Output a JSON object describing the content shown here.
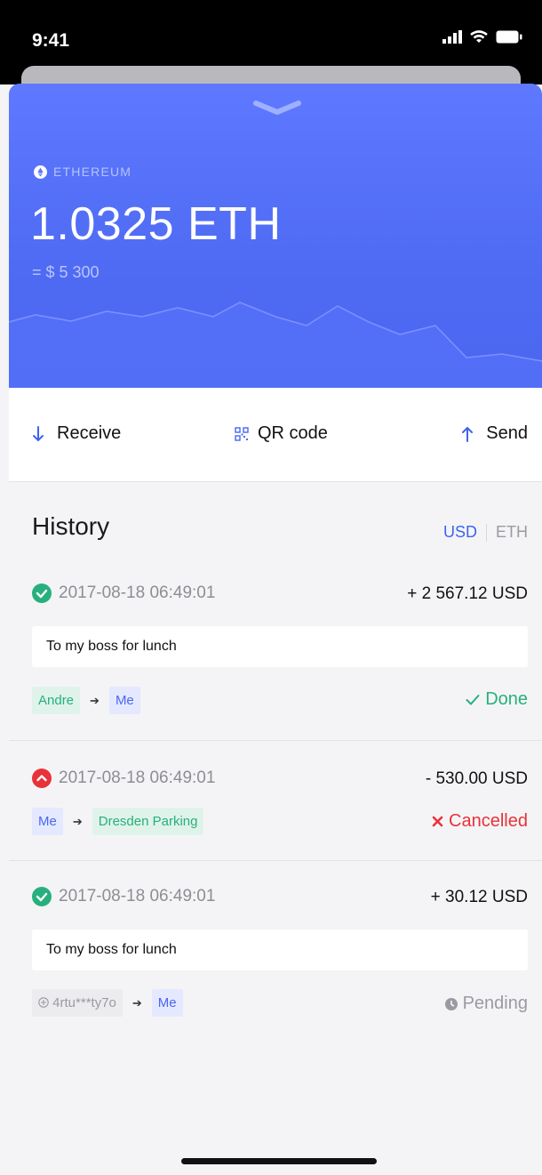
{
  "status_bar": {
    "time": "9:41"
  },
  "wallet": {
    "coin": "ETHEREUM",
    "balance": "1.0325 ETH",
    "fiat_value": "= $ 5 300"
  },
  "actions": {
    "receive": "Receive",
    "qr_code": "QR code",
    "send": "Send"
  },
  "history": {
    "title": "History",
    "currencies": [
      "USD",
      "ETH"
    ],
    "selected_currency": "USD",
    "transactions": [
      {
        "status_icon": "check-circle-icon",
        "date": "2017-08-18 06:49:01",
        "amount": "+ 2 567.12 USD",
        "note": "To my boss for lunch",
        "from": "Andre",
        "to": "Me",
        "status": "Done"
      },
      {
        "status_icon": "up-arrow-circle-icon",
        "date": "2017-08-18 06:49:01",
        "amount": "- 530.00 USD",
        "from": "Me",
        "to": "Dresden Parking",
        "status": "Cancelled"
      },
      {
        "status_icon": "check-circle-icon",
        "date": "2017-08-18 06:49:01",
        "amount": "+ 30.12 USD",
        "note": "To my boss for lunch",
        "from": "4rtu***ty7o",
        "to": "Me",
        "status": "Pending"
      }
    ]
  },
  "colors": {
    "accent_blue": "#4f6bf3",
    "success_green": "#27b07d",
    "error_red": "#e8323a",
    "pending_grey": "#9a9aa2"
  }
}
